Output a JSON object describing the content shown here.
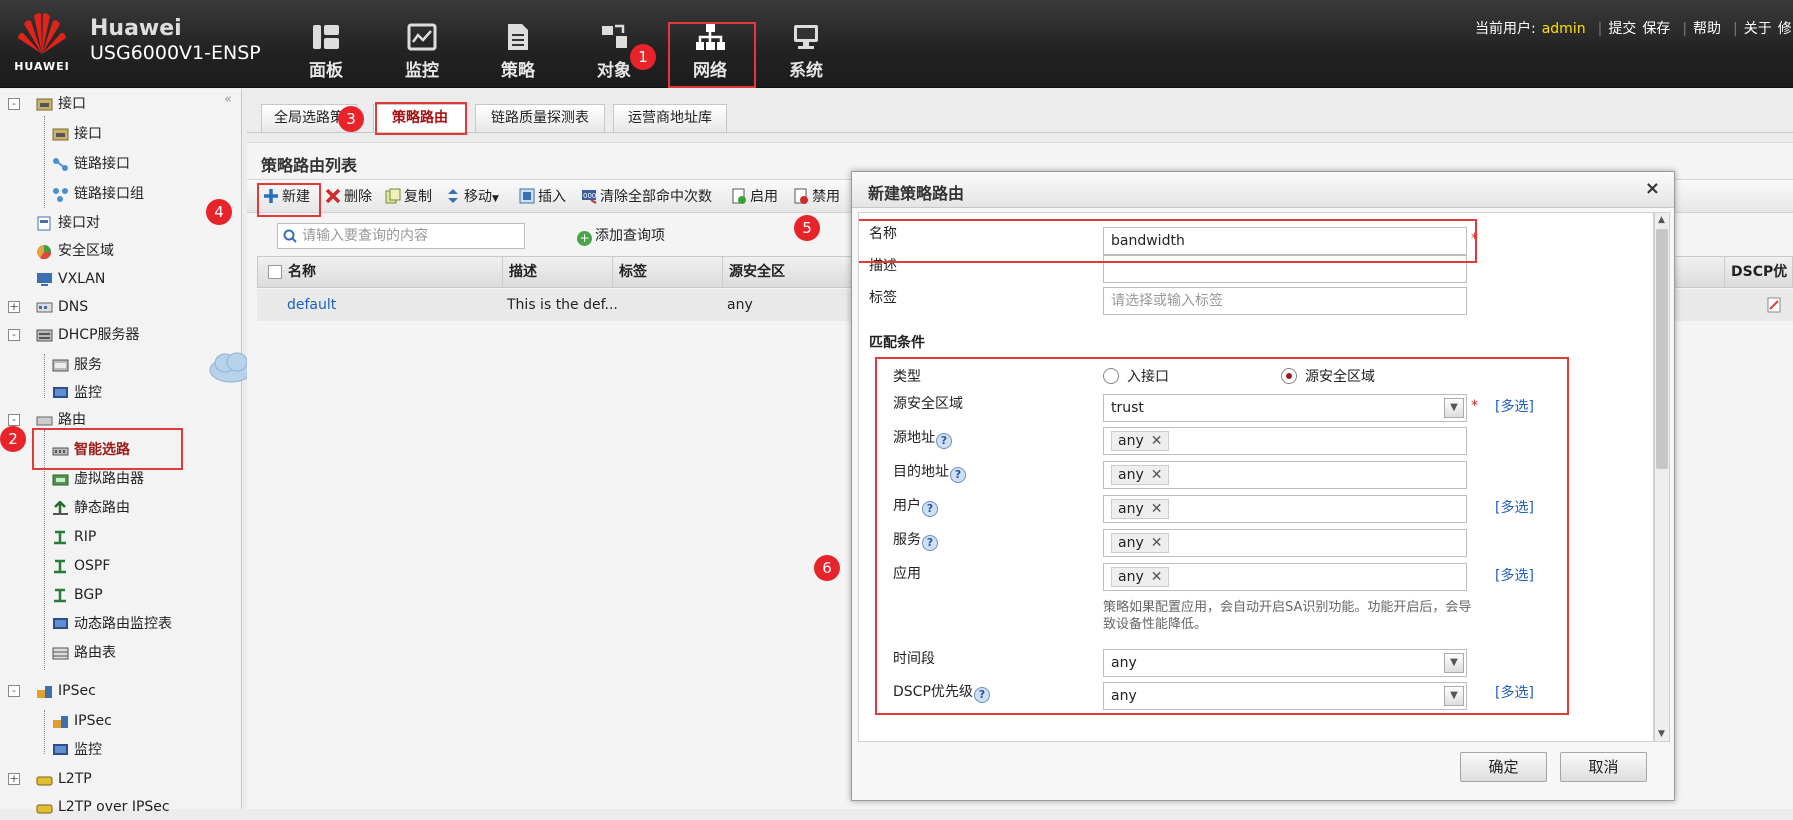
{
  "brand": {
    "logo_text": "HUAWEI",
    "line1": "Huawei",
    "line2": "USG6000V1-ENSP"
  },
  "nav": [
    {
      "label": "面板",
      "icon": "dashboard-icon"
    },
    {
      "label": "监控",
      "icon": "monitor-chart-icon"
    },
    {
      "label": "策略",
      "icon": "policy-document-icon"
    },
    {
      "label": "对象",
      "icon": "object-icon"
    },
    {
      "label": "网络",
      "icon": "network-topology-icon"
    },
    {
      "label": "系统",
      "icon": "system-computer-icon"
    }
  ],
  "topright": {
    "user_prefix": "当前用户:",
    "user": "admin",
    "commit": "提交",
    "save": "保存",
    "help": "帮助",
    "about": "关于",
    "extra": "修"
  },
  "badges": {
    "b1": "1",
    "b2": "2",
    "b3": "3",
    "b4": "4",
    "b5": "5",
    "b6": "6"
  },
  "sidebar": {
    "collapse": "«",
    "items": [
      {
        "label": "接口",
        "toggle": "-"
      },
      {
        "label": "接口"
      },
      {
        "label": "链路接口"
      },
      {
        "label": "链路接口组"
      },
      {
        "label": "接口对"
      },
      {
        "label": "安全区域"
      },
      {
        "label": "VXLAN"
      },
      {
        "label": "DNS",
        "toggle": "+"
      },
      {
        "label": "DHCP服务器",
        "toggle": "-"
      },
      {
        "label": "服务"
      },
      {
        "label": "监控"
      },
      {
        "label": "路由",
        "toggle": "-"
      },
      {
        "label": "智能选路"
      },
      {
        "label": "虚拟路由器"
      },
      {
        "label": "静态路由"
      },
      {
        "label": "RIP"
      },
      {
        "label": "OSPF"
      },
      {
        "label": "BGP"
      },
      {
        "label": "动态路由监控表"
      },
      {
        "label": "路由表"
      },
      {
        "label": "IPSec",
        "toggle": "-"
      },
      {
        "label": "IPSec"
      },
      {
        "label": "监控"
      },
      {
        "label": "L2TP",
        "toggle": "+"
      },
      {
        "label": "L2TP over IPSec"
      }
    ]
  },
  "tabs": [
    {
      "label": "全局选路策"
    },
    {
      "label": "策略路由"
    },
    {
      "label": "链路质量探测表"
    },
    {
      "label": "运营商地址库"
    }
  ],
  "panel": {
    "title": "策略路由列表"
  },
  "toolbar": {
    "new": "新建",
    "delete": "删除",
    "copy": "复制",
    "move": "移动",
    "insert": "插入",
    "clear_hits": "清除全部命中次数",
    "enable": "启用",
    "disable": "禁用"
  },
  "search": {
    "placeholder": "请输入要查询的内容",
    "add_query": "添加查询项"
  },
  "grid": {
    "columns": [
      "名称",
      "描述",
      "标签",
      "源安全区",
      "DSCP优"
    ],
    "rows": [
      {
        "name": "default",
        "desc": "This is the def...",
        "tag": "",
        "src_zone": "any"
      }
    ]
  },
  "dialog": {
    "title": "新建策略路由",
    "close": "×",
    "name_label": "名称",
    "name_value": "bandwidth",
    "desc_label": "描述",
    "desc_value": "",
    "tag_label": "标签",
    "tag_placeholder": "请选择或输入标签",
    "section": "匹配条件",
    "type_label": "类型",
    "radio_in": "入接口",
    "radio_zone": "源安全区域",
    "src_zone_label": "源安全区域",
    "src_zone_value": "trust",
    "src_addr_label": "源地址",
    "src_addr_value": "any",
    "dst_addr_label": "目的地址",
    "dst_addr_value": "any",
    "user_label": "用户",
    "user_value": "any",
    "service_label": "服务",
    "service_value": "any",
    "app_label": "应用",
    "app_value": "any",
    "app_note": "策略如果配置应用，会自动开启SA识别功能。功能开启后，会导致设备性能降低。",
    "time_label": "时间段",
    "time_value": "any",
    "dscp_label": "DSCP优先级",
    "dscp_value": "any",
    "multi": "[多选]",
    "required": "*",
    "help": "?",
    "chip_close": "✕",
    "ok": "确定",
    "cancel": "取消"
  },
  "colors": {
    "accent_red": "#e23a3a",
    "active_tab": "#a11111",
    "link_blue": "#1f5fbf",
    "user_yellow": "#ffe000"
  }
}
